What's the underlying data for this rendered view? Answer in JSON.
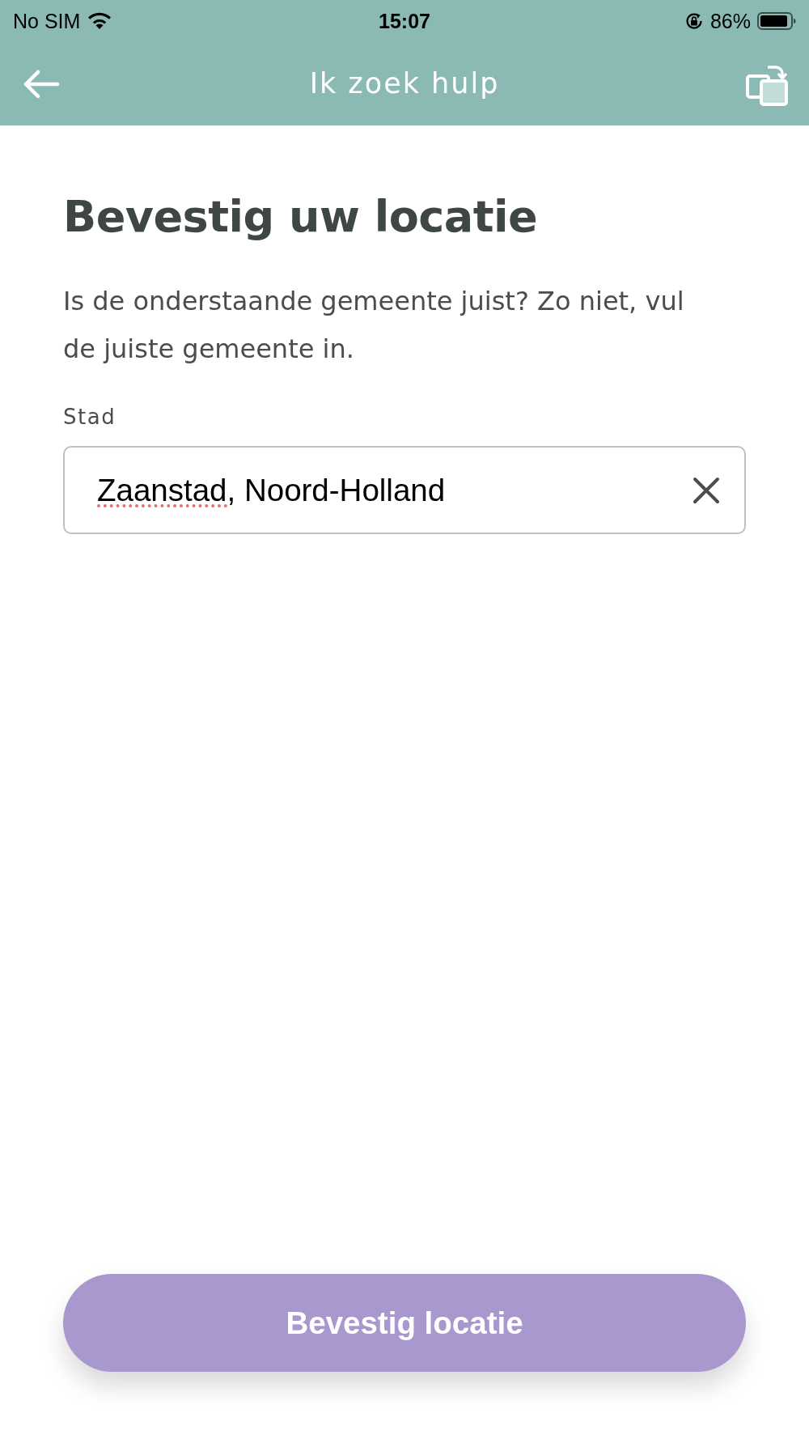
{
  "status_bar": {
    "carrier": "No SIM",
    "time": "15:07",
    "battery_percent": "86%"
  },
  "header": {
    "title": "Ik zoek hulp"
  },
  "page": {
    "heading": "Bevestig uw locatie",
    "description": "Is de onderstaande gemeente juist? Zo niet, vul de juiste gemeente in.",
    "field": {
      "label": "Stad",
      "value": "Zaanstad, Noord-Holland",
      "spelling_flagged": true
    },
    "button": {
      "label": "Bevestig locatie"
    }
  }
}
